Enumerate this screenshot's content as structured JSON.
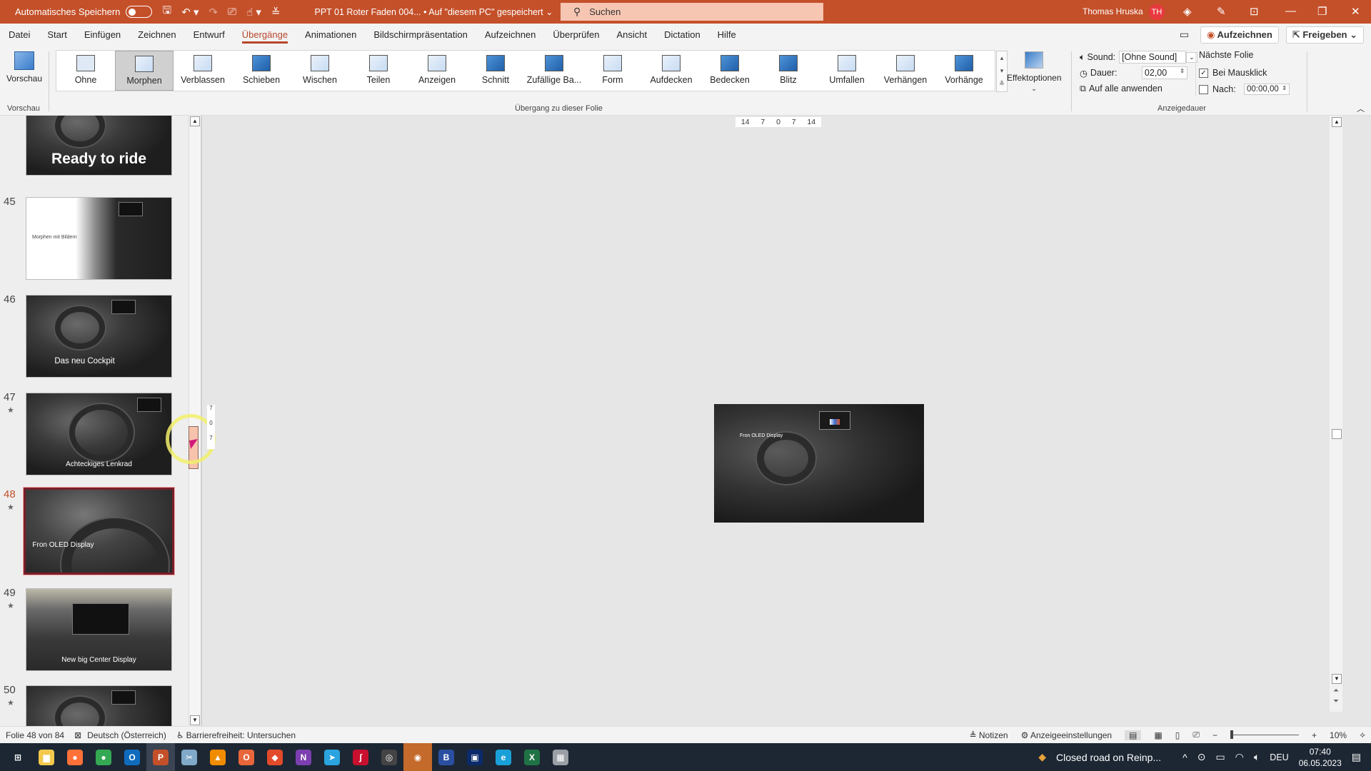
{
  "titlebar": {
    "autosave_label": "Automatisches Speichern",
    "autosave_state": "off",
    "doc_title": "PPT 01 Roter Faden 004... • Auf \"diesem PC\" gespeichert",
    "search_placeholder": "Suchen",
    "user_name": "Thomas Hruska",
    "user_initials": "TH",
    "accent": "#c4502a",
    "avatar_color": "#e8393f"
  },
  "tabs": [
    {
      "label": "Datei"
    },
    {
      "label": "Start"
    },
    {
      "label": "Einfügen"
    },
    {
      "label": "Zeichnen"
    },
    {
      "label": "Entwurf"
    },
    {
      "label": "Übergänge",
      "active": true
    },
    {
      "label": "Animationen"
    },
    {
      "label": "Bildschirmpräsentation"
    },
    {
      "label": "Aufzeichnen"
    },
    {
      "label": "Überprüfen"
    },
    {
      "label": "Ansicht"
    },
    {
      "label": "Dictation"
    },
    {
      "label": "Hilfe"
    }
  ],
  "tab_actions": {
    "record_label": "Aufzeichnen",
    "share_label": "Freigeben"
  },
  "ribbon": {
    "preview_label": "Vorschau",
    "preview_group_label": "Vorschau",
    "transitions_group_label": "Übergang zu dieser Folie",
    "transitions": [
      {
        "label": "Ohne"
      },
      {
        "label": "Morphen",
        "selected": true
      },
      {
        "label": "Verblassen"
      },
      {
        "label": "Schieben"
      },
      {
        "label": "Wischen"
      },
      {
        "label": "Teilen"
      },
      {
        "label": "Anzeigen"
      },
      {
        "label": "Schnitt"
      },
      {
        "label": "Zufällige Ba..."
      },
      {
        "label": "Form"
      },
      {
        "label": "Aufdecken"
      },
      {
        "label": "Bedecken"
      },
      {
        "label": "Blitz"
      },
      {
        "label": "Umfallen"
      },
      {
        "label": "Verhängen"
      },
      {
        "label": "Vorhänge"
      }
    ],
    "effect_options_label": "Effektoptionen",
    "timing": {
      "sound_label": "Sound:",
      "sound_value": "[Ohne Sound]",
      "duration_label": "Dauer:",
      "duration_value": "02,00",
      "apply_all_label": "Auf alle anwenden",
      "next_slide_label": "Nächste Folie",
      "on_click_label": "Bei Mausklick",
      "on_click_checked": true,
      "after_label": "Nach:",
      "after_checked": false,
      "after_value": "00:00,00",
      "group_label": "Anzeigedauer"
    }
  },
  "slides": [
    {
      "number": "",
      "caption": "Ready to ride",
      "star": false
    },
    {
      "number": "45",
      "caption": "Morphen mit Bildern",
      "star": false
    },
    {
      "number": "46",
      "caption": "Das neu Cockpit",
      "star": false
    },
    {
      "number": "47",
      "caption": "Achteckiges Lenkrad",
      "star": true
    },
    {
      "number": "48",
      "caption": "Fron OLED Display",
      "star": true,
      "selected": true
    },
    {
      "number": "49",
      "caption": "New big Center Display",
      "star": true
    },
    {
      "number": "50",
      "caption": "",
      "star": true
    }
  ],
  "ruler": {
    "horizontal": [
      "14",
      "7",
      "0",
      "7",
      "14"
    ],
    "vertical": [
      "7",
      "0",
      "7"
    ]
  },
  "main_slide": {
    "caption": "Fron OLED Display"
  },
  "statusbar": {
    "slide_info": "Folie 48 von 84",
    "language": "Deutsch (Österreich)",
    "accessibility": "Barrierefreiheit: Untersuchen",
    "notes_label": "Notizen",
    "display_settings_label": "Anzeigeeinstellungen",
    "zoom_percent": "10%"
  },
  "taskbar": {
    "apps": [
      {
        "name": "windows-start",
        "glyph": "⊞",
        "color": "#ffffff"
      },
      {
        "name": "file-explorer",
        "glyph": "▆",
        "color": "#f2c94c"
      },
      {
        "name": "firefox",
        "glyph": "●",
        "color": "#ff7139"
      },
      {
        "name": "chrome",
        "glyph": "●",
        "color": "#34a853"
      },
      {
        "name": "outlook",
        "glyph": "O",
        "color": "#0f6cbd"
      },
      {
        "name": "powerpoint",
        "glyph": "P",
        "color": "#c4502a",
        "active": true
      },
      {
        "name": "snipping-tool",
        "glyph": "✂",
        "color": "#7fa8c9"
      },
      {
        "name": "vlc",
        "glyph": "▲",
        "color": "#f08c00"
      },
      {
        "name": "office",
        "glyph": "O",
        "color": "#e8663a"
      },
      {
        "name": "app-red",
        "glyph": "◆",
        "color": "#e24a2a"
      },
      {
        "name": "onenote",
        "glyph": "N",
        "color": "#7b3fb0"
      },
      {
        "name": "telegram",
        "glyph": "➤",
        "color": "#2aa3df"
      },
      {
        "name": "app-pdf",
        "glyph": "ʃ",
        "color": "#c8102e"
      },
      {
        "name": "obs",
        "glyph": "◎",
        "color": "#444444"
      },
      {
        "name": "recorder",
        "glyph": "◉",
        "color": "#c46a2a",
        "highlight": true
      },
      {
        "name": "blue-app",
        "glyph": "B",
        "color": "#2b4fa0"
      },
      {
        "name": "video-app",
        "glyph": "▣",
        "color": "#0a2a6a"
      },
      {
        "name": "edge",
        "glyph": "e",
        "color": "#1aa0d8"
      },
      {
        "name": "excel",
        "glyph": "X",
        "color": "#1f7244"
      },
      {
        "name": "app-gray",
        "glyph": "▦",
        "color": "#9aa0a6"
      }
    ],
    "notification_text": "Closed road on Reinp...",
    "language": "DEU",
    "time": "07:40",
    "date": "06.05.2023"
  }
}
